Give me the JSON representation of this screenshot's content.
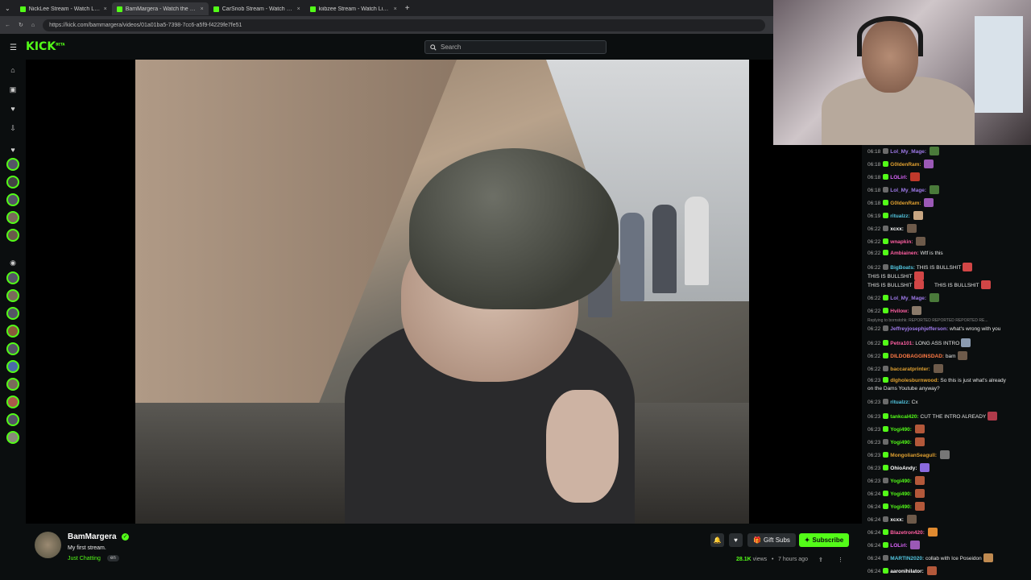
{
  "browser": {
    "tabs": [
      {
        "title": "NickLee Stream - Watch Live o",
        "active": false
      },
      {
        "title": "BamMargera - Watch the VOD",
        "active": true
      },
      {
        "title": "CarSnob Stream - Watch Live",
        "active": false
      },
      {
        "title": "kiibzee Stream - Watch Live o",
        "active": false
      }
    ],
    "new_tab": "+",
    "url": "https://kick.com/bammargera/videos/01a01ba5-7398-7cc6-a5f9-f4229fe7fe51"
  },
  "header": {
    "logo": "KICK",
    "logo_sup": "BETA",
    "search_placeholder": "Search"
  },
  "channel": {
    "name": "BamMargera",
    "title": "My first stream.",
    "category": "Just Chatting",
    "language": "en",
    "views": "28.1K",
    "views_label": "views",
    "separator": "•",
    "time_ago": "7 hours ago",
    "gift_subs": "Gift Subs",
    "subscribe": "Subscribe",
    "accent": "#53fc18"
  },
  "chat": {
    "messages": [
      {
        "time": "06:18",
        "user": "Lol_My_Mage:",
        "color": "#9f7aea",
        "text": "",
        "emote": "#4a7a3a"
      },
      {
        "time": "06:18",
        "user": "G0ldenRam:",
        "color": "#e0a030",
        "text": "",
        "emote": "#9b59b6"
      },
      {
        "time": "06:18",
        "user": "LOLirl:",
        "color": "#e066ff",
        "text": "",
        "emote": "#c0392b"
      },
      {
        "time": "06:18",
        "user": "Lol_My_Mage:",
        "color": "#9f7aea",
        "text": "",
        "emote": "#4a7a3a"
      },
      {
        "time": "06:18",
        "user": "G0ldenRam:",
        "color": "#e0a030",
        "text": "",
        "emote": "#9b59b6"
      },
      {
        "time": "06:19",
        "user": "ritualzz:",
        "color": "#53c6e0",
        "text": "",
        "emote": "#c8a682"
      },
      {
        "time": "06:22",
        "user": "xcxx:",
        "color": "#ffffff",
        "text": "",
        "emote": "#6d5a4a"
      },
      {
        "time": "06:22",
        "user": "wnapkin:",
        "color": "#ff5fa2",
        "text": "",
        "emote": "#6d5a4a"
      },
      {
        "time": "06:22",
        "user": "Ambiainen:",
        "color": "#ff5fa2",
        "text": "Wtf is this",
        "emote": ""
      },
      {
        "time": "06:22",
        "user": "BigBoats:",
        "color": "#53c6e0",
        "text": "THIS IS BULLSHIT",
        "emote": "#d24646"
      },
      {
        "time": "",
        "user": "",
        "color": "",
        "text": "THIS IS BULLSHIT",
        "emote": "#d24646"
      },
      {
        "time": "",
        "user": "",
        "color": "",
        "text": "THIS IS BULLSHIT",
        "emote": "#d24646"
      },
      {
        "time": "",
        "user": "",
        "color": "",
        "text": "THIS IS BULLSHIT",
        "emote": "#d24646"
      },
      {
        "time": "06:22",
        "user": "Lol_My_Mage:",
        "color": "#9f7aea",
        "text": "",
        "emote": "#4a7a3a"
      },
      {
        "time": "06:22",
        "user": "Hvilow:",
        "color": "#ff5fa2",
        "text": "",
        "emote": "#8a7a6a"
      },
      {
        "time": "06:22",
        "user": "Jeffreyjosephjefferson:",
        "color": "#9f7aea",
        "text": "what's wrong with you",
        "emote": ""
      },
      {
        "time": "06:22",
        "user": "Petra101:",
        "color": "#ff5fa2",
        "text": "LONG ASS INTRO",
        "emote": "#8a9ab0"
      },
      {
        "time": "06:22",
        "user": "DILDOBAGGINSDAD:",
        "color": "#ff7a45",
        "text": "bam",
        "emote": "#6d5a4a"
      },
      {
        "time": "06:22",
        "user": "baccaratprinter:",
        "color": "#e0a030",
        "text": "",
        "emote": "#6d5a4a"
      },
      {
        "time": "06:23",
        "user": "dlgholesburnwood:",
        "color": "#e0a030",
        "text": "So this is just what's already",
        "emote": ""
      },
      {
        "time": "",
        "user": "",
        "color": "",
        "text": "on the Dams Youtube anyway?",
        "emote": ""
      },
      {
        "time": "06:23",
        "user": "ritualzz:",
        "color": "#53c6e0",
        "text": "Cx",
        "emote": ""
      },
      {
        "time": "06:23",
        "user": "tankcal420:",
        "color": "#53fc18",
        "text": "CUT THE INTRO ALREADY",
        "emote": "#b03a4a"
      },
      {
        "time": "06:23",
        "user": "Yogi490:",
        "color": "#53fc18",
        "text": "",
        "emote": "#b3583a"
      },
      {
        "time": "06:23",
        "user": "Yogi490:",
        "color": "#53fc18",
        "text": "",
        "emote": "#b3583a"
      },
      {
        "time": "06:23",
        "user": "MongolianSeagull:",
        "color": "#e0a030",
        "text": "",
        "emote": "#777777"
      },
      {
        "time": "06:23",
        "user": "OhioAndy:",
        "color": "#ffffff",
        "text": "",
        "emote": "#8a6adf"
      },
      {
        "time": "06:23",
        "user": "Yogi490:",
        "color": "#53fc18",
        "text": "",
        "emote": "#b3583a"
      },
      {
        "time": "06:24",
        "user": "Yogi490:",
        "color": "#53fc18",
        "text": "",
        "emote": "#b3583a"
      },
      {
        "time": "06:24",
        "user": "Yogi490:",
        "color": "#53fc18",
        "text": "",
        "emote": "#b3583a"
      },
      {
        "time": "06:24",
        "user": "xcxx:",
        "color": "#ffffff",
        "text": "",
        "emote": "#6d5a4a"
      },
      {
        "time": "06:24",
        "user": "Blazetron420:",
        "color": "#ff5fa2",
        "text": "",
        "emote": "#e08a30"
      },
      {
        "time": "06:24",
        "user": "LOLirl:",
        "color": "#e066ff",
        "text": "",
        "emote": "#9b59b6"
      },
      {
        "time": "06:24",
        "user": "MARTIN2020:",
        "color": "#53c6e0",
        "text": "collab with Ice Poseidon",
        "emote": "#c08a50"
      },
      {
        "time": "06:24",
        "user": "aaronihilator:",
        "color": "#ffffff",
        "text": "",
        "emote": "#b3583a"
      }
    ],
    "reply_note": "Replying to bornstohk: REPORTED REPORTED REPORTED RE..."
  }
}
